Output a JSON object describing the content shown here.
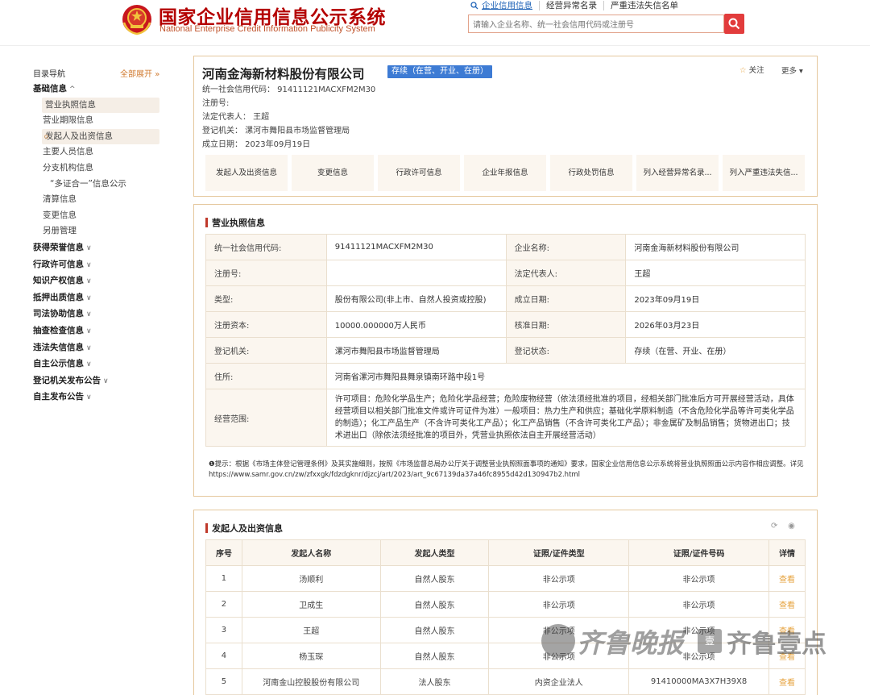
{
  "header": {
    "logo_cn": "国家企业信用信息公示系统",
    "logo_en": "National Enterprise Credit Information Publicity System",
    "nav": [
      "企业信用信息",
      "经营异常名录",
      "严重违法失信名单"
    ],
    "search_placeholder": "请输入企业名称、统一社会信用代码或注册号"
  },
  "sidebar": {
    "title": "目录导航",
    "expand_all": "全部展开",
    "expand_icon": "chevron-double-down",
    "groups": [
      {
        "label": "基础信息",
        "chev": "^"
      },
      {
        "label": "获得荣誉信息",
        "chev": "∨"
      },
      {
        "label": "行政许可信息",
        "chev": "∨"
      },
      {
        "label": "知识产权信息",
        "chev": "∨"
      },
      {
        "label": "抵押出质信息",
        "chev": "∨"
      },
      {
        "label": "司法协助信息",
        "chev": "∨"
      },
      {
        "label": "抽查检查信息",
        "chev": "∨"
      },
      {
        "label": "违法失信信息",
        "chev": "∨"
      },
      {
        "label": "自主公示信息",
        "chev": "∨"
      },
      {
        "label": "登记机关发布公告",
        "chev": "∨"
      },
      {
        "label": "自主发布公告",
        "chev": "∨"
      }
    ],
    "basic_items": [
      "营业执照信息",
      "营业期限信息",
      "发起人及出资信息",
      "主要人员信息",
      "分支机构信息",
      "“多证合一”信息公示",
      "清算信息",
      "变更信息",
      "另册管理"
    ]
  },
  "company": {
    "name": "河南金海新材料股份有限公司",
    "status": "存续（在营、开业、在册）",
    "follow": "关注",
    "more": "更多",
    "credit_code_line": "统一社会信用代码： 91411121MACXFM2M30",
    "reg_no_line": "注册号:",
    "legal_rep_line": "法定代表人： 王超",
    "reg_authority_line": "登记机关： 漯河市舞阳县市场监督管理局",
    "established_line": "成立日期： 2023年09月19日",
    "actions": [
      "发起人及出资信息",
      "变更信息",
      "行政许可信息",
      "企业年报信息",
      "行政处罚信息",
      "列入经营异常名录...",
      "列入严重违法失信..."
    ]
  },
  "license": {
    "title": "营业执照信息",
    "rows": [
      {
        "l1": "统一社会信用代码:",
        "v1": "91411121MACXFM2M30",
        "l2": "企业名称:",
        "v2": "河南金海新材料股份有限公司"
      },
      {
        "l1": "注册号:",
        "v1": "",
        "l2": "法定代表人:",
        "v2": "王超"
      },
      {
        "l1": "类型:",
        "v1": "股份有限公司(非上市、自然人投资或控股)",
        "l2": "成立日期:",
        "v2": "2023年09月19日"
      },
      {
        "l1": "注册资本:",
        "v1": "10000.000000万人民币",
        "l2": "核准日期:",
        "v2": "2026年03月23日"
      },
      {
        "l1": "登记机关:",
        "v1": "漯河市舞阳县市场监督管理局",
        "l2": "登记状态:",
        "v2": "存续（在营、开业、在册）"
      }
    ],
    "address_label": "住所:",
    "address": "河南省漯河市舞阳县舞泉镇南环路中段1号",
    "scope_label": "经营范围:",
    "scope": "许可项目：危险化学品生产；危险化学品经营；危险废物经营（依法须经批准的项目，经相关部门批准后方可开展经营活动，具体经营项目以相关部门批准文件或许可证件为准）一般项目：热力生产和供应；基础化学原料制造（不含危险化学品等许可类化学品的制造）；化工产品生产（不含许可类化工产品）；化工产品销售（不含许可类化工产品）；非金属矿及制品销售；货物进出口；技术进出口（除依法须经批准的项目外，凭营业执照依法自主开展经营活动）",
    "notice": "❶提示：根据《市场主体登记管理条例》及其实施细则，按照《市场监督总局办公厅关于调整营业执照照面事项的通知》要求，国家企业信用信息公示系统将营业执照照面公示内容作相应调整。详见https://www.samr.gov.cn/zw/zfxxgk/fdzdgknr/djzcj/art/2023/art_9c67139da37a46fc8955d42d130947b2.html"
  },
  "investors": {
    "title": "发起人及出资信息",
    "columns": [
      "序号",
      "发起人名称",
      "发起人类型",
      "证照/证件类型",
      "证照/证件号码",
      "详情"
    ],
    "rows": [
      {
        "no": "1",
        "name": "汤顺利",
        "type": "自然人股东",
        "id_type": "非公示项",
        "id_no": "非公示项",
        "detail": "查看"
      },
      {
        "no": "2",
        "name": "卫成生",
        "type": "自然人股东",
        "id_type": "非公示项",
        "id_no": "非公示项",
        "detail": "查看"
      },
      {
        "no": "3",
        "name": "王超",
        "type": "自然人股东",
        "id_type": "非公示项",
        "id_no": "非公示项",
        "detail": "查看"
      },
      {
        "no": "4",
        "name": "杨玉琛",
        "type": "自然人股东",
        "id_type": "非公示项",
        "id_no": "非公示项",
        "detail": "查看"
      },
      {
        "no": "5",
        "name": "河南金山控股股份有限公司",
        "type": "法人股东",
        "id_type": "内资企业法人",
        "id_no": "91410000MA3X7H39X8",
        "detail": "查看"
      }
    ]
  },
  "watermark": {
    "left": "齐鲁晚报",
    "box": "壹",
    "right": "齐鲁壹点"
  }
}
